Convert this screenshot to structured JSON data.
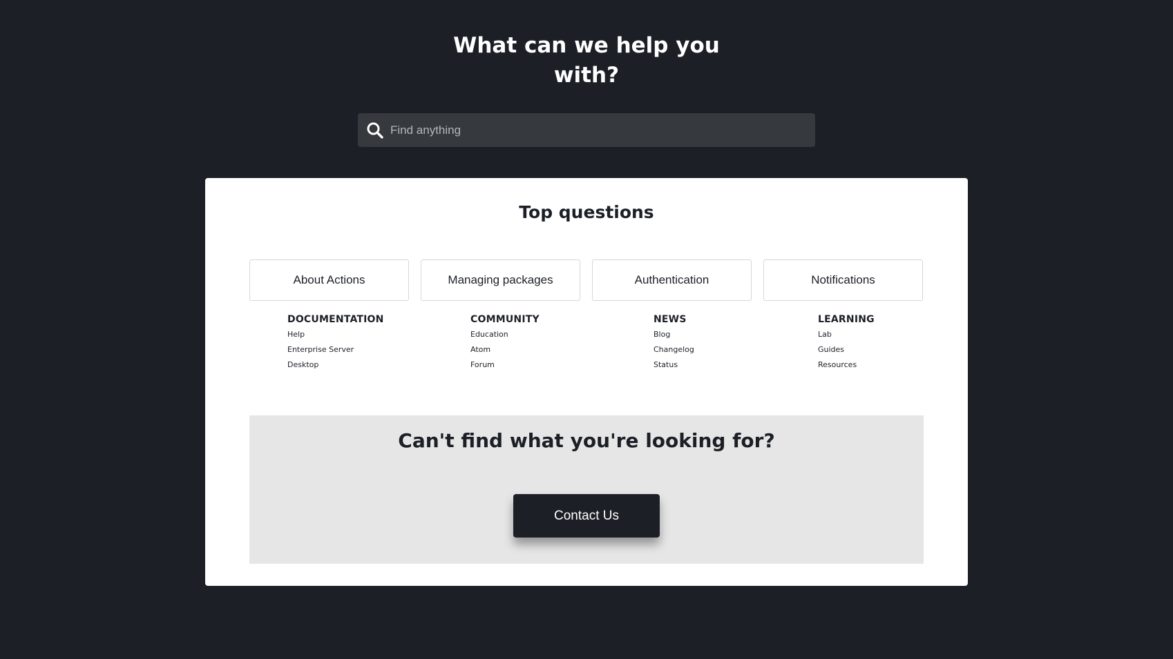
{
  "hero": {
    "title_line1": "What can we help you",
    "title_line2": "with?"
  },
  "search": {
    "placeholder": "Find anything",
    "icon": "search-icon"
  },
  "top_questions": {
    "title": "Top questions",
    "items": [
      {
        "label": "About Actions"
      },
      {
        "label": "Managing packages"
      },
      {
        "label": "Authentication"
      },
      {
        "label": "Notifications"
      }
    ]
  },
  "link_columns": [
    {
      "title": "DOCUMENTATION",
      "links": [
        "Help",
        "Enterprise Server",
        "Desktop"
      ]
    },
    {
      "title": "COMMUNITY",
      "links": [
        "Education",
        "Atom",
        "Forum"
      ]
    },
    {
      "title": "NEWS",
      "links": [
        "Blog",
        "Changelog",
        "Status"
      ]
    },
    {
      "title": "LEARNING",
      "links": [
        "Lab",
        "Guides",
        "Resources"
      ]
    }
  ],
  "contact": {
    "title": "Can't find what you're looking for?",
    "button_label": "Contact Us"
  },
  "colors": {
    "background": "#1c1f26",
    "search_bg": "#363a3f",
    "card_bg": "#ffffff",
    "contact_panel_bg": "#e6e6e6",
    "contact_button_bg": "#1c1f26"
  }
}
